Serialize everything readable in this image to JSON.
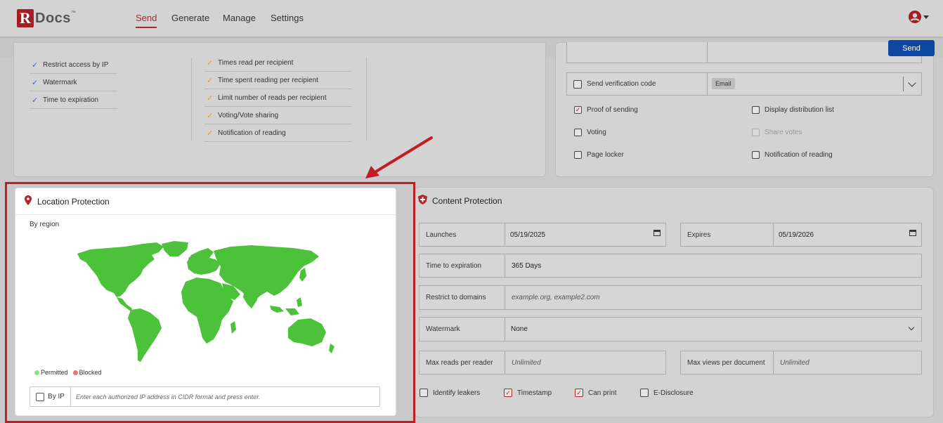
{
  "brand": {
    "logo_letter": "R",
    "logo_text": "Docs",
    "logo_tm": "™"
  },
  "nav": {
    "links": [
      "Send",
      "Generate",
      "Manage",
      "Settings"
    ],
    "active": "Send"
  },
  "toolbar": {
    "send_label": "Send"
  },
  "tracking_left": {
    "items": [
      "Restrict access by IP",
      "Watermark",
      "Time to expiration"
    ]
  },
  "tracking_middle": {
    "items": [
      "Times read per recipient",
      "Time spent reading per recipient",
      "Limit number of reads per recipient",
      "Voting/Vote sharing",
      "Notification of reading"
    ]
  },
  "options": {
    "verification_label": "Send verification code",
    "verification_method": "Email",
    "proof_of_sending": "Proof of sending",
    "display_distribution_list": "Display distribution list",
    "voting": "Voting",
    "share_votes": "Share votes",
    "page_locker": "Page locker",
    "notification_of_reading": "Notification of reading"
  },
  "location": {
    "title": "Location Protection",
    "by_region": "By region",
    "legend_permitted": "Permitted",
    "legend_blocked": "Blocked",
    "by_ip_label": "By IP",
    "ip_placeholder": "Enter each authorized IP address in CIDR format and press enter."
  },
  "content": {
    "title": "Content Protection",
    "launches_label": "Launches",
    "launches_value": "05/19/2025",
    "expires_label": "Expires",
    "expires_value": "05/19/2026",
    "time_to_expiration_label": "Time to expiration",
    "time_to_expiration_value": "365 Days",
    "restrict_domains_label": "Restrict to domains",
    "restrict_domains_placeholder": "example.org, example2.com",
    "watermark_label": "Watermark",
    "watermark_value": "None",
    "max_reads_label": "Max reads per reader",
    "max_reads_value": "Unlimited",
    "max_views_label": "Max views per document",
    "max_views_value": "Unlimited",
    "identify_leakers": "Identify leakers",
    "timestamp": "Timestamp",
    "can_print": "Can print",
    "e_disclosure": "E-Disclosure"
  },
  "colors": {
    "accent": "#b0242a",
    "send_button": "#0d47a1",
    "map_fill": "#4cc13a",
    "highlight_box": "#c21d22"
  }
}
